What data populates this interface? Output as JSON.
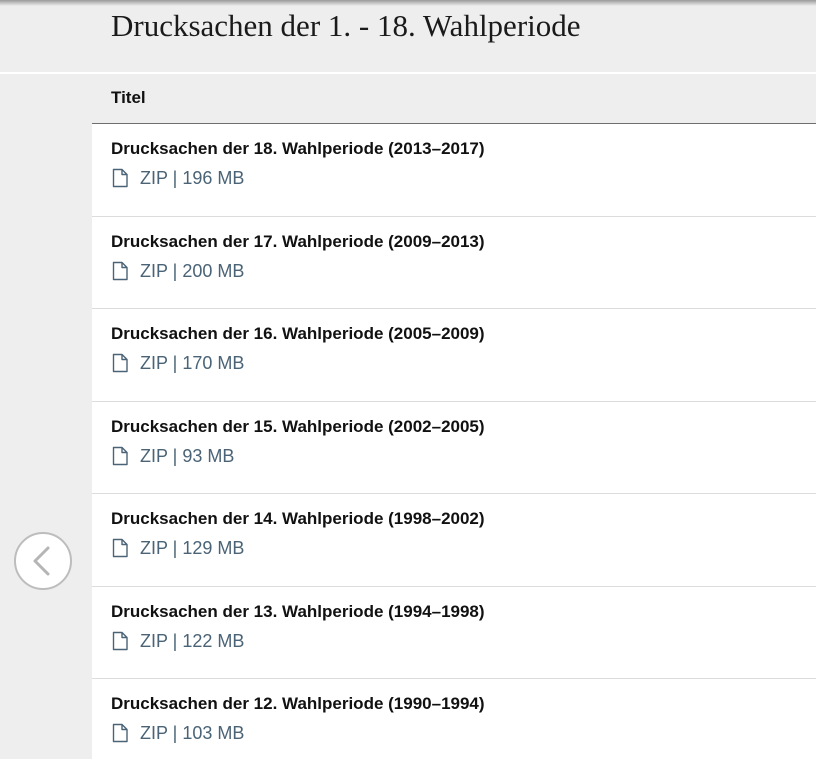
{
  "page": {
    "title": "Drucksachen der 1. - 18. Wahlperiode"
  },
  "table": {
    "column_header": "Titel",
    "rows": [
      {
        "title": "Drucksachen der 18. Wahlperiode (2013–2017)",
        "file": "ZIP | 196 MB"
      },
      {
        "title": "Drucksachen der 17. Wahlperiode (2009–2013)",
        "file": "ZIP | 200 MB"
      },
      {
        "title": "Drucksachen der 16. Wahlperiode (2005–2009)",
        "file": "ZIP | 170 MB"
      },
      {
        "title": "Drucksachen der 15. Wahlperiode (2002–2005)",
        "file": "ZIP | 93 MB"
      },
      {
        "title": "Drucksachen der 14. Wahlperiode (1998–2002)",
        "file": "ZIP | 129 MB"
      },
      {
        "title": "Drucksachen der 13. Wahlperiode (1994–1998)",
        "file": "ZIP | 122 MB"
      },
      {
        "title": "Drucksachen der 12. Wahlperiode (1990–1994)",
        "file": "ZIP | 103 MB"
      }
    ]
  },
  "icons": {
    "file": "file-icon",
    "previous": "chevron-left-icon"
  },
  "colors": {
    "link": "#4a6376",
    "background": "#eeeeee"
  }
}
